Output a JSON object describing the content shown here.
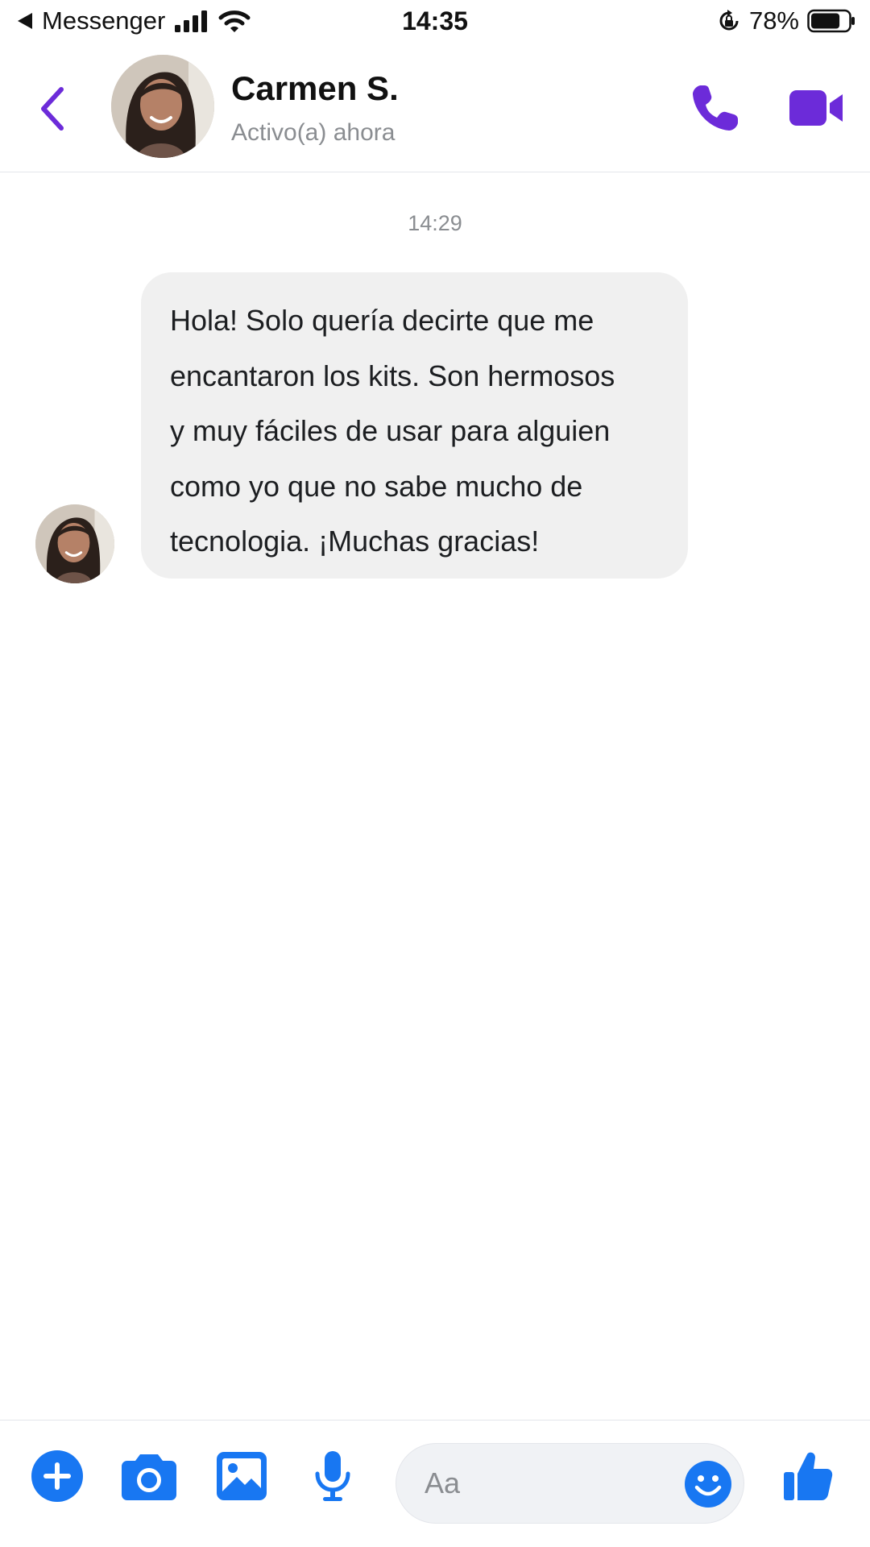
{
  "status_bar": {
    "back_app": "Messenger",
    "time": "14:35",
    "battery": "78%",
    "battery_level": 0.78
  },
  "header": {
    "contact_name": "Carmen S.",
    "contact_status": "Activo(a) ahora"
  },
  "conversation": {
    "timestamp": "14:29",
    "messages": [
      {
        "sender": "Carmen S.",
        "text": "Hola! Solo quería decirte que me\nencantaron los kits. Son hermosos\ny muy fáciles de usar para alguien\ncomo yo que no sabe mucho de\ntecnologia. ¡Muchas gracias!"
      }
    ]
  },
  "composer": {
    "placeholder": "Aa",
    "value": ""
  },
  "colors": {
    "accent_purple": "#6c2bd9",
    "accent_blue": "#1877f2",
    "bubble_bg": "#f0f0f0"
  },
  "icons": {
    "back": "chevron-left-icon",
    "call": "phone-icon",
    "video": "video-camera-icon",
    "plus": "plus-icon",
    "camera": "camera-icon",
    "gallery": "image-icon",
    "mic": "microphone-icon",
    "emoji": "smiley-icon",
    "like": "thumbs-up-icon"
  }
}
